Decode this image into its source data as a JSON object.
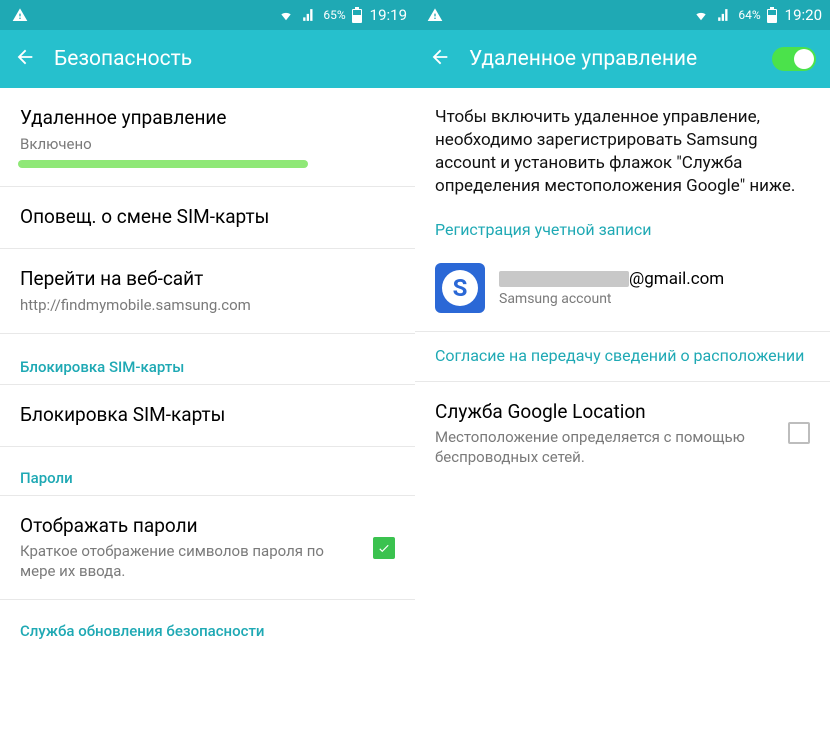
{
  "left": {
    "status": {
      "battery": "65%",
      "time": "19:19"
    },
    "title": "Безопасность",
    "items": [
      {
        "title": "Удаленное управление",
        "sub": "Включено"
      },
      {
        "title": "Оповещ. о смене SIM-карты"
      },
      {
        "title": "Перейти на веб-сайт",
        "sub": "http://findmymobile.samsung.com"
      }
    ],
    "sim_section": "Блокировка SIM-карты",
    "sim_item": "Блокировка SIM-карты",
    "pwd_section": "Пароли",
    "pwd_item": {
      "title": "Отображать пароли",
      "sub": "Краткое отображение символов пароля по мере их ввода."
    },
    "update_link": "Служба обновления безопасности"
  },
  "right": {
    "status": {
      "battery": "64%",
      "time": "19:20"
    },
    "title": "Удаленное управление",
    "info": "Чтобы включить удаленное управление, необходимо зарегистрировать Samsung account и установить флажок \"Служба определения местоположения Google\" ниже.",
    "register_link": "Регистрация учетной записи",
    "account": {
      "email_suffix": "@gmail.com",
      "label": "Samsung account"
    },
    "consent_link": "Согласие на передачу сведений о расположении",
    "location": {
      "title": "Служба Google Location",
      "sub": "Местоположение определяется с помощью беспроводных сетей."
    }
  }
}
